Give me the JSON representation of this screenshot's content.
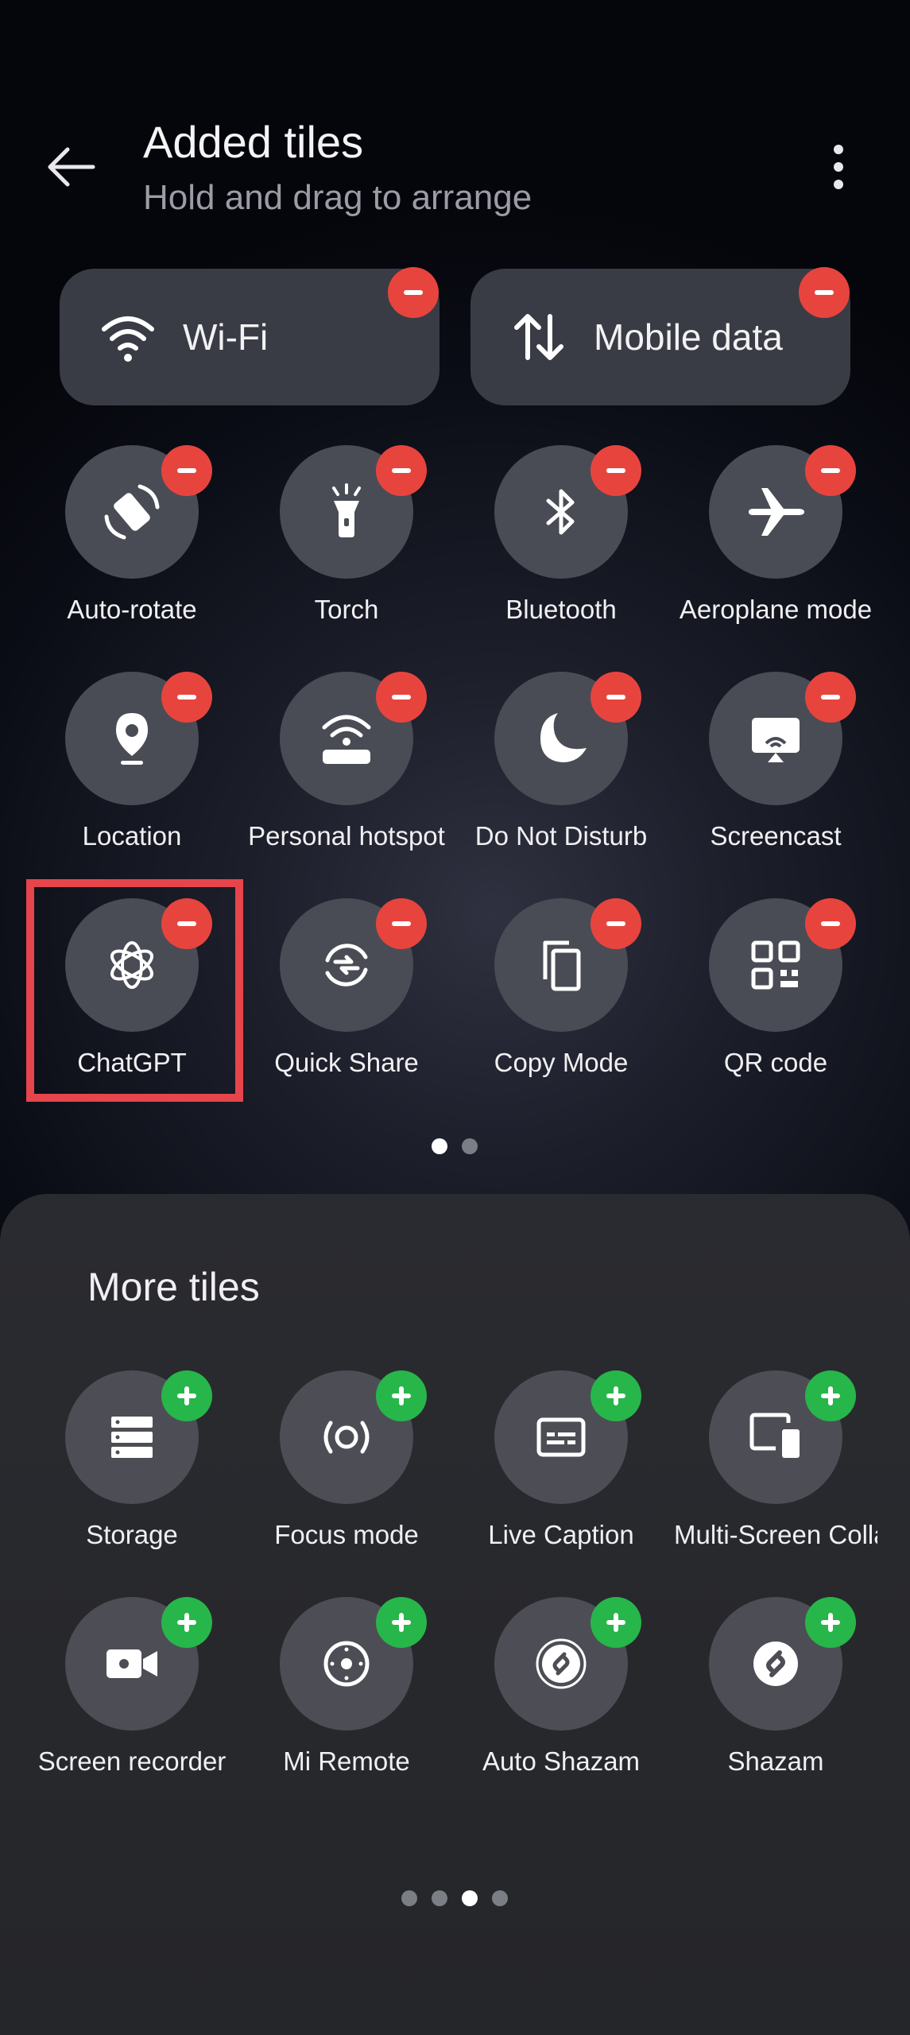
{
  "header": {
    "title": "Added tiles",
    "subtitle": "Hold and drag to arrange",
    "back_icon": "arrow-left-icon",
    "more_icon": "more-vert-icon"
  },
  "added_wide_tiles": [
    {
      "label": "Wi-Fi",
      "icon": "wifi-icon"
    },
    {
      "label": "Mobile data",
      "icon": "mobile-data-icon"
    }
  ],
  "added_tiles": [
    {
      "label": "Auto-rotate",
      "icon": "auto-rotate-icon"
    },
    {
      "label": "Torch",
      "icon": "torch-icon"
    },
    {
      "label": "Bluetooth",
      "icon": "bluetooth-icon"
    },
    {
      "label": "Aeroplane mode",
      "icon": "aeroplane-icon"
    },
    {
      "label": "Location",
      "icon": "location-icon"
    },
    {
      "label": "Personal hotspot",
      "icon": "hotspot-icon"
    },
    {
      "label": "Do Not Disturb",
      "icon": "moon-icon"
    },
    {
      "label": "Screencast",
      "icon": "screencast-icon"
    },
    {
      "label": "ChatGPT",
      "icon": "chatgpt-icon"
    },
    {
      "label": "Quick Share",
      "icon": "quick-share-icon"
    },
    {
      "label": "Copy Mode",
      "icon": "copy-icon"
    },
    {
      "label": "QR code",
      "icon": "qr-code-icon"
    }
  ],
  "added_pager": {
    "count": 2,
    "active": 0
  },
  "more": {
    "title": "More tiles",
    "tiles": [
      {
        "label": "Storage",
        "icon": "storage-icon"
      },
      {
        "label": "Focus mode",
        "icon": "focus-mode-icon"
      },
      {
        "label": "Live Caption",
        "icon": "live-caption-icon"
      },
      {
        "label": "Multi-Screen Collaboration",
        "icon": "multi-screen-icon"
      },
      {
        "label": "Screen recorder",
        "icon": "video-camera-icon"
      },
      {
        "label": "Mi Remote",
        "icon": "remote-icon"
      },
      {
        "label": "Auto Shazam",
        "icon": "auto-shazam-icon"
      },
      {
        "label": "Shazam",
        "icon": "shazam-icon"
      }
    ],
    "pager": {
      "count": 4,
      "active": 2
    }
  },
  "colors": {
    "remove_badge": "#e8443e",
    "add_badge": "#27b64a",
    "highlight": "#e6454b"
  }
}
